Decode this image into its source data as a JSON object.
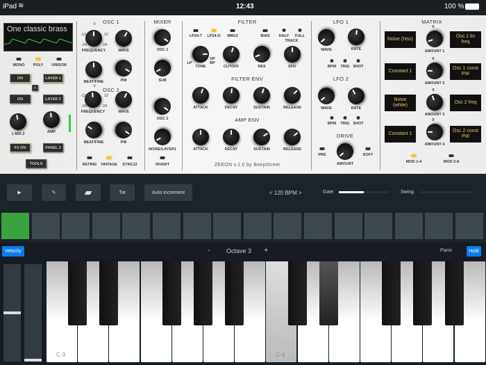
{
  "status": {
    "device": "iPad",
    "time": "12:43",
    "battery": "100 %"
  },
  "display": {
    "preset": "One classic brass"
  },
  "voice": {
    "mono": "MONO",
    "poly": "POLY",
    "unison": "UNISON",
    "mode": "poly"
  },
  "layer": {
    "on1": "ON",
    "layer1": "LAYER 1",
    "plus": "+",
    "on2": "ON",
    "layer2": "LAYER 2",
    "fx": "FX ON",
    "panel2": "PANEL 2",
    "tools": "TOOLS"
  },
  "osc1": {
    "title": "OSC 1",
    "freq_marks": [
      "-12",
      "0",
      "12",
      "-24",
      "24"
    ]
  },
  "osc2": {
    "title": "OSC 2",
    "freq_marks": [
      "-12",
      "0",
      "12",
      "-24",
      "24"
    ]
  },
  "osc_leds": {
    "retrig": "RETRIG",
    "vintage": "VINTAGE",
    "sync": "SYNC12",
    "active": "vintage"
  },
  "mixer": {
    "title": "MIXER",
    "invert": "INVERT"
  },
  "filter": {
    "title": "FILTER",
    "modes": [
      "LP24-T",
      "LP24-O",
      "MM12"
    ],
    "active_mode": "LP24-O",
    "bias": "BIAS",
    "half": "HALF",
    "full": "FULL",
    "track": "TRACK",
    "tone_marks": [
      "LP",
      "HP",
      "BP"
    ],
    "env_title": "FILTER ENV",
    "amp_title": "AMP ENV"
  },
  "credit": "ZEEON v.1.0  by BeepStreet",
  "lfo1": {
    "title": "LFO 1",
    "bpm": "BPM",
    "trig": "TRIG",
    "shot": "SHOT"
  },
  "lfo2": {
    "title": "LFO 2",
    "bpm": "BPM",
    "trig": "TRIG",
    "shot": "SHOT"
  },
  "drive": {
    "title": "DRIVE",
    "pre": "PRE",
    "soft": "SOFT"
  },
  "matrix": {
    "title": "MATRIX",
    "sources": [
      "Noise (hiss)",
      "Constant 1",
      "Noise (white)",
      "Constant 1"
    ],
    "destinations": [
      "Osc 1 lin freq",
      "Osc 1 const PW",
      "Osc 2 freq",
      "Osc 2 const PW"
    ],
    "zero": "0",
    "mod14": "MOD 1-4",
    "mod58": "MOD 5-8",
    "active_bank": "MOD 1-4"
  },
  "knobs": [
    {
      "id": "mix",
      "label": "1 MIX 2",
      "value": 0.46
    },
    {
      "id": "amp",
      "label": "AMP",
      "value": 0.48
    },
    {
      "id": "osc1-frequency",
      "label": "FREQUENCY",
      "value": 0.5
    },
    {
      "id": "osc1-wave",
      "label": "WAVE",
      "value": 0.61
    },
    {
      "id": "osc1-beatfine",
      "label": "BEAT/FINE",
      "value": 0.5
    },
    {
      "id": "osc1-pw",
      "label": "PW",
      "value": 0.94
    },
    {
      "id": "osc2-frequency",
      "label": "FREQUENCY",
      "value": 0.48
    },
    {
      "id": "osc2-wave",
      "label": "WAVE",
      "value": 0.6
    },
    {
      "id": "osc2-beatfine",
      "label": "BEAT/FINE",
      "value": 0.28
    },
    {
      "id": "osc2-pw",
      "label": "PW",
      "value": 0.96
    },
    {
      "id": "mixer-osc1",
      "label": "OSC 1",
      "value": 0.96
    },
    {
      "id": "mixer-sub",
      "label": "SUB",
      "value": 0.06
    },
    {
      "id": "mixer-osc2",
      "label": "OSC 2",
      "value": 0.96
    },
    {
      "id": "mixer-noise",
      "label": "NOISE/LAYER1",
      "value": 0.06
    },
    {
      "id": "filter-tone",
      "label": "TONE",
      "value": 0.83
    },
    {
      "id": "filter-cutoff",
      "label": "CUTOFF",
      "value": 0.56
    },
    {
      "id": "filter-res",
      "label": "RES",
      "value": 0.09
    },
    {
      "id": "filter-env",
      "label": "ENV",
      "value": 0.5
    },
    {
      "id": "fenv-attack",
      "label": "ATTACK",
      "value": 0.57
    },
    {
      "id": "fenv-decay",
      "label": "DECAY",
      "value": 0.52
    },
    {
      "id": "fenv-sustain",
      "label": "SUSTAIN",
      "value": 0.56
    },
    {
      "id": "fenv-release",
      "label": "RELEASE",
      "value": 0.67
    },
    {
      "id": "aenv-attack",
      "label": "ATTACK",
      "value": 0.5
    },
    {
      "id": "aenv-decay",
      "label": "DECAY",
      "value": 0.5
    },
    {
      "id": "aenv-sustain",
      "label": "SUSTAIN",
      "value": 0.72
    },
    {
      "id": "aenv-release",
      "label": "RELEASE",
      "value": 0.69
    },
    {
      "id": "lfo1-wave",
      "label": "WAVE",
      "value": 0.02
    },
    {
      "id": "lfo1-rate",
      "label": "RATE",
      "value": 0.52
    },
    {
      "id": "lfo2-wave",
      "label": "WAVE",
      "value": 0.02
    },
    {
      "id": "lfo2-rate",
      "label": "RATE",
      "value": 0.39
    },
    {
      "id": "drive-amount",
      "label": "AMOUNT",
      "value": 0.02
    },
    {
      "id": "matrix-amount-1",
      "label": "AMOUNT 1",
      "value": 0.09
    },
    {
      "id": "matrix-amount-2",
      "label": "AMOUNT 2",
      "value": 0.17
    },
    {
      "id": "matrix-amount-3",
      "label": "AMOUNT 3",
      "value": 0.43
    },
    {
      "id": "matrix-amount-4",
      "label": "AMOUNT 4",
      "value": 0.17
    }
  ],
  "sequencer": {
    "tie": "Tie",
    "auto": "Auto increment",
    "bpm": "< 120 BPM >",
    "gate": "Gate",
    "gate_value": 0.5,
    "swing": "Swing",
    "swing_value": 0,
    "steps": 16,
    "active_step": 1,
    "step_color": "#3aa23f"
  },
  "keyboard": {
    "velocity": "Velocity",
    "minus": "-",
    "octave": "Octave 3",
    "plus": "+",
    "panic": "Panic",
    "hold": "Hold",
    "c3": "C-3",
    "c4": "C-4",
    "pressed": [
      "C-4",
      "D#-4"
    ],
    "slider1_value": 0.5,
    "slider2_value": 0.0
  }
}
